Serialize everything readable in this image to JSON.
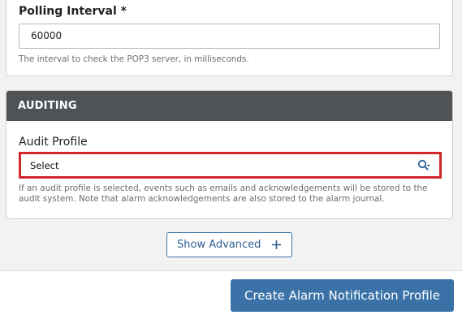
{
  "polling": {
    "label": "Polling Interval *",
    "value": "60000",
    "help": "The interval to check the POP3 server, in milliseconds."
  },
  "auditing": {
    "section_title": "AUDITING",
    "audit_profile_label": "Audit Profile",
    "select_value": "Select",
    "select_icon": "search-dropdown-icon",
    "help": "If an audit profile is selected, events such as emails and acknowledgements will be stored to the audit system. Note that alarm acknowledgements are also stored to the alarm journal.",
    "highlight_color": "#d3262a"
  },
  "advanced": {
    "label": "Show Advanced",
    "icon": "plus-icon"
  },
  "footer": {
    "create_label": "Create Alarm Notification Profile",
    "button_color": "#3a72a7"
  }
}
